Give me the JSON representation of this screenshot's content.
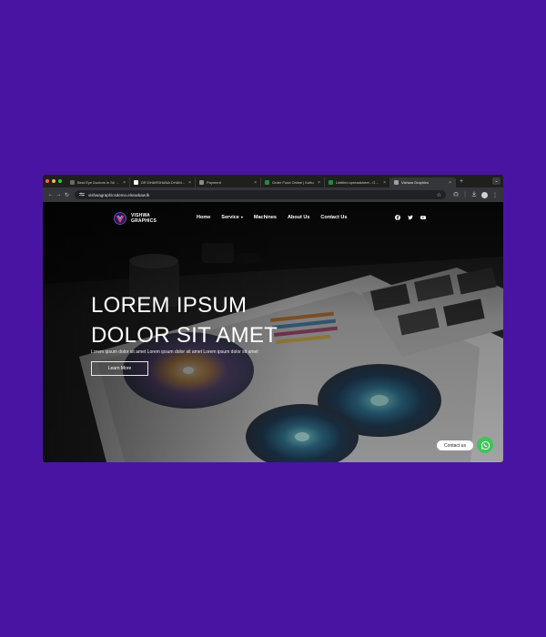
{
  "browser": {
    "tabs": [
      {
        "title": "Best Eye Doctors in Sri Lanka",
        "favicon_color": "#6a6a6a",
        "active": false
      },
      {
        "title": "DR DHARSHANA DHAMMIKA",
        "favicon_color": "#ffffff",
        "active": false
      },
      {
        "title": "Payment",
        "favicon_color": "#8a8a8a",
        "active": false
      },
      {
        "title": "Order Food Online | Kottu",
        "favicon_color": "#1e8e3e",
        "active": false
      },
      {
        "title": "Untitled spreadsheet - Google Sheets",
        "favicon_color": "#1e8e3e",
        "active": false
      },
      {
        "title": "Vishwa Graphics",
        "favicon_color": "#9aa0a6",
        "active": true
      }
    ],
    "new_tab_symbol": "+",
    "tab_close_symbol": "×",
    "tab_menu_symbol": "⌄",
    "url": "vishwagraphicsdemo.elsowbaw.lk",
    "nav_icons": {
      "back": "←",
      "forward": "→",
      "reload": "↻"
    },
    "toolbar_icons": [
      "star-icon",
      "extensions-icon",
      "download-icon",
      "profile-icon",
      "menu-icon"
    ]
  },
  "site": {
    "logo_line1": "VISHWA",
    "logo_line2": "GRAPHICS",
    "menu": {
      "home": "Home",
      "service": "Service",
      "machines": "Machines",
      "about": "About Us",
      "contact": "Contact Us"
    },
    "social_icons": [
      "facebook-icon",
      "twitter-icon",
      "youtube-icon"
    ],
    "hero": {
      "headline_line1": "LOREM IPSUM",
      "headline_line2": "DOLOR SIT AMET",
      "subline": "Lorem ipsum dolor sit amet Lorem ipsum dolor sit amet Lorem ipsum dolor sit amet",
      "button": "Learn More"
    },
    "contact_widget": {
      "label": "Contact us",
      "icon": "whatsapp-icon",
      "color": "#3ec45a"
    }
  },
  "colors": {
    "backdrop": "#4a14a3",
    "browser_chrome": "#35363a",
    "tabstrip": "#1f1f1f"
  }
}
